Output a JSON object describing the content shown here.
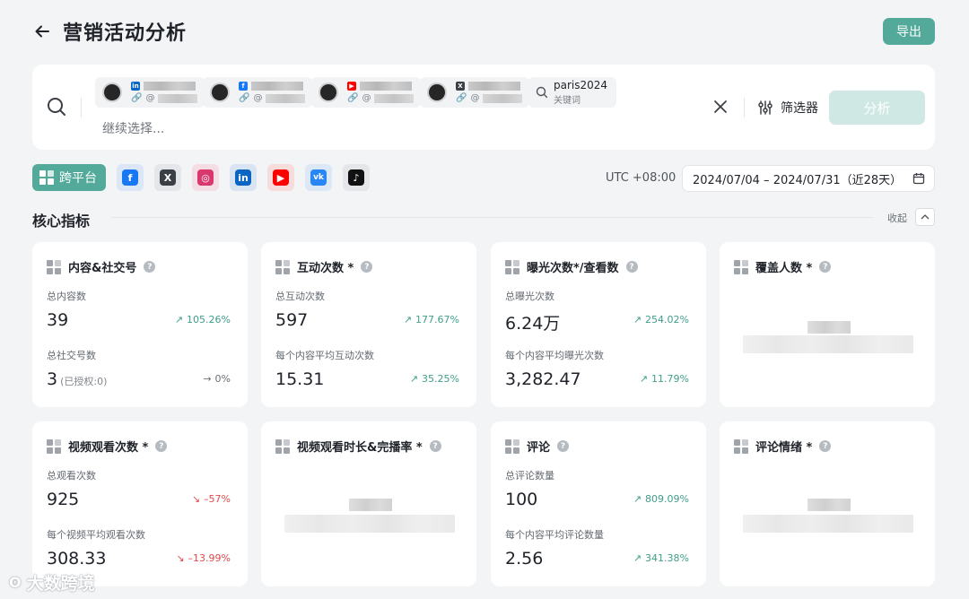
{
  "header": {
    "title": "营销活动分析",
    "export_label": "导出"
  },
  "search": {
    "continue_placeholder": "继续选择...",
    "accounts": [
      {
        "platform": "linkedin",
        "at": "@"
      },
      {
        "platform": "facebook",
        "at": "@"
      },
      {
        "platform": "youtube",
        "at": "@"
      },
      {
        "platform": "x",
        "at": "@"
      }
    ],
    "keyword": {
      "value": "paris2024",
      "label": "关键词"
    },
    "filter_label": "筛选器",
    "analyze_label": "分析"
  },
  "platform_tabs": {
    "cross_label": "跨平台",
    "items": [
      {
        "name": "facebook",
        "glyph": "f",
        "bg": "#1877f2",
        "tint": "#dbe6f6"
      },
      {
        "name": "x",
        "glyph": "𝕏",
        "bg": "#3b4046",
        "tint": "#e4e6e9"
      },
      {
        "name": "instagram",
        "glyph": "◎",
        "bg": "#d8386e",
        "tint": "#f5dde4"
      },
      {
        "name": "linkedin",
        "glyph": "in",
        "bg": "#0a66c2",
        "tint": "#d9e4f2"
      },
      {
        "name": "youtube",
        "glyph": "▶",
        "bg": "#ff0000",
        "tint": "#f7dcdc"
      },
      {
        "name": "vk",
        "glyph": "vk",
        "bg": "#2787f5",
        "tint": "#dde8f6"
      },
      {
        "name": "tiktok",
        "glyph": "♪",
        "bg": "#111111",
        "tint": "#e4e6e9"
      }
    ]
  },
  "timezone": "UTC +08:00",
  "date_range": "2024/07/04 – 2024/07/31（近28天）",
  "section": {
    "title": "核心指标",
    "collapse_label": "收起"
  },
  "cards": {
    "content": {
      "title": "内容&社交号",
      "m1_label": "总内容数",
      "m1_value": "39",
      "m1_change": "105.26%",
      "m2_label": "总社交号数",
      "m2_value": "3",
      "m2_sub": "(已授权:0)",
      "m2_change": "0%"
    },
    "interaction": {
      "title": "互动次数 *",
      "m1_label": "总互动次数",
      "m1_value": "597",
      "m1_change": "177.67%",
      "m2_label": "每个内容平均互动次数",
      "m2_value": "15.31",
      "m2_change": "35.25%"
    },
    "exposure": {
      "title": "曝光次数*/查看数",
      "m1_label": "总曝光次数",
      "m1_value": "6.24万",
      "m1_change": "254.02%",
      "m2_label": "每个内容平均曝光次数",
      "m2_value": "3,282.47",
      "m2_change": "11.79%"
    },
    "reach": {
      "title": "覆盖人数 *"
    },
    "video_views": {
      "title": "视频观看次数 *",
      "m1_label": "总观看次数",
      "m1_value": "925",
      "m1_change": "–57%",
      "m2_label": "每个视频平均观看次数",
      "m2_value": "308.33",
      "m2_change": "–13.99%"
    },
    "watch_time": {
      "title": "视频观看时长&完播率 *"
    },
    "comments": {
      "title": "评论",
      "m1_label": "总评论数量",
      "m1_value": "100",
      "m1_change": "809.09%",
      "m2_label": "每个内容平均评论数量",
      "m2_value": "2.56",
      "m2_change": "341.38%"
    },
    "sentiment": {
      "title": "评论情绪 *"
    }
  },
  "watermark": "大数跨境"
}
